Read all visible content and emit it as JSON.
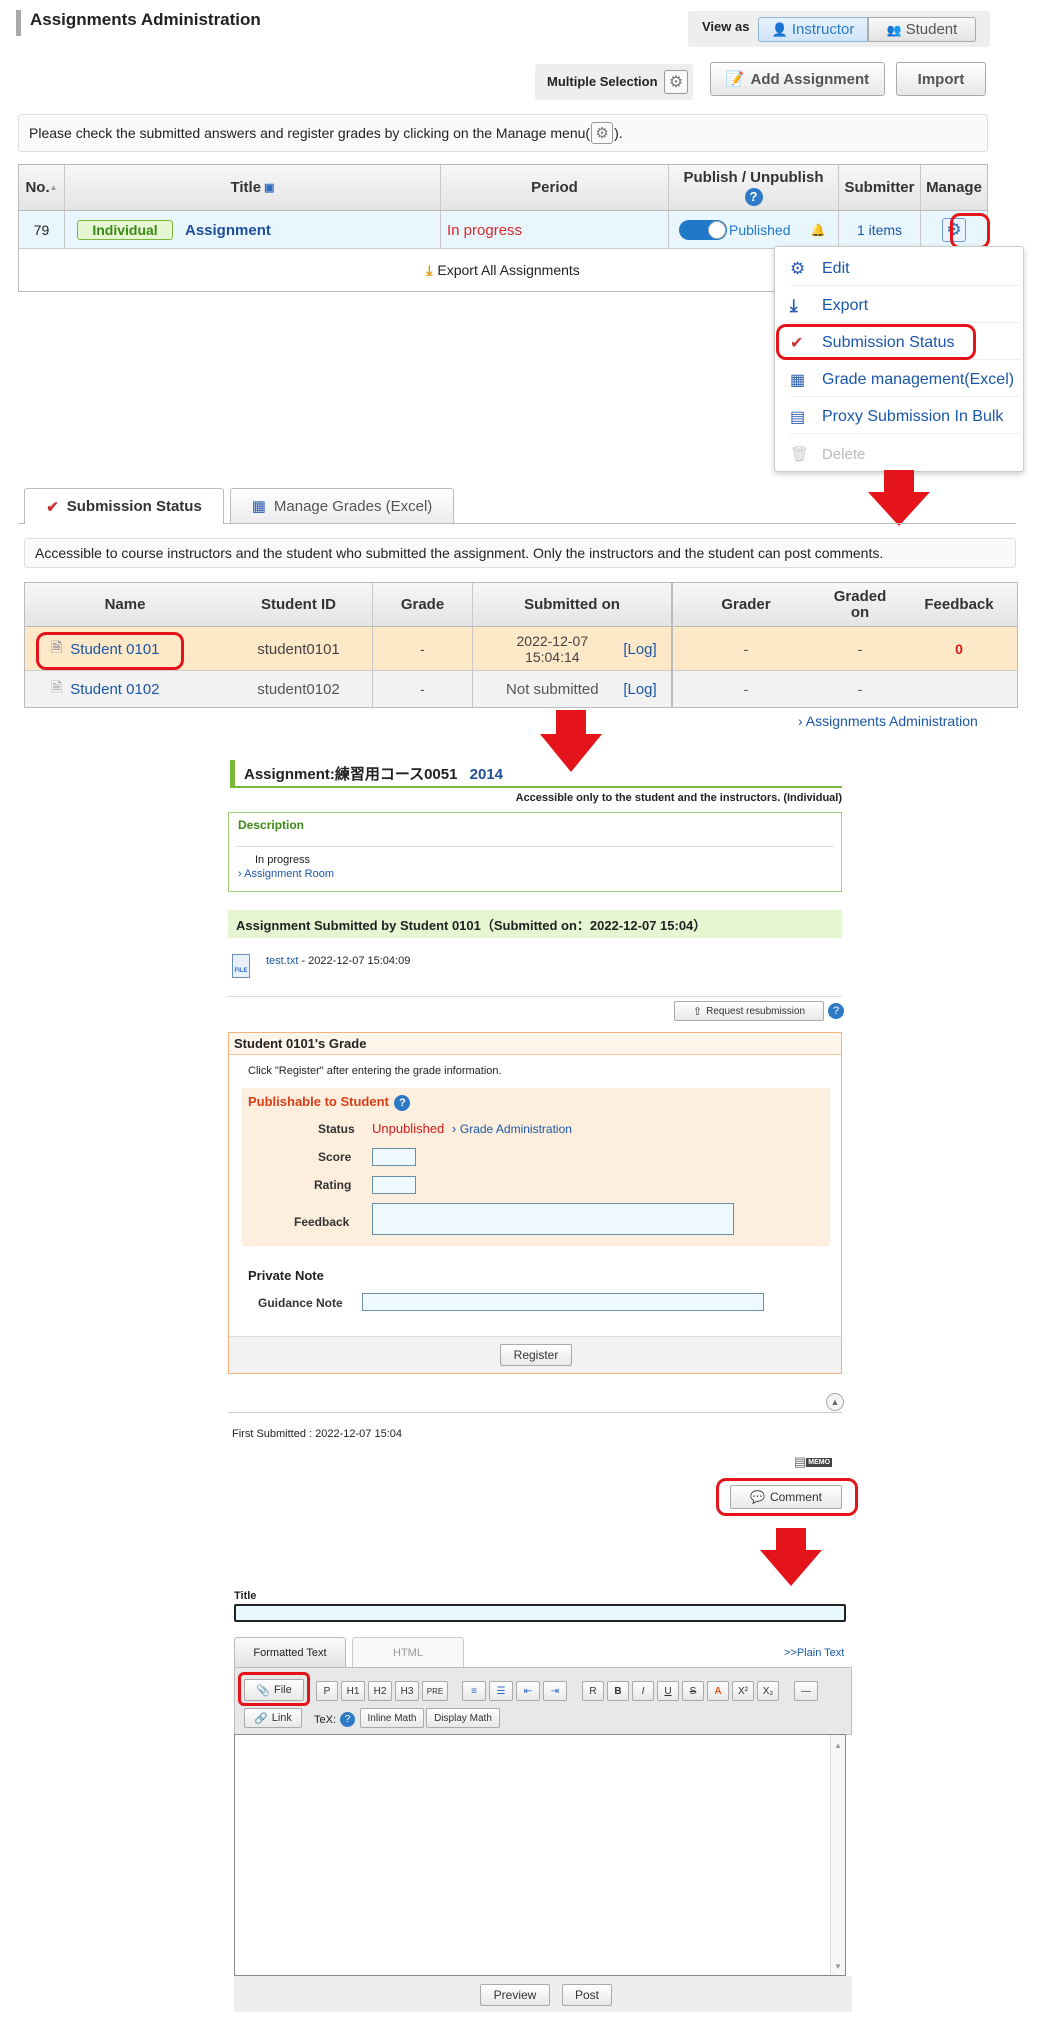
{
  "admin": {
    "title": "Assignments Administration",
    "view_as_label": "View as",
    "view_instructor": "Instructor",
    "view_student": "Student",
    "multiple_selection": "Multiple Selection",
    "add_assignment": "Add Assignment",
    "import": "Import",
    "info": "Please check the submitted answers and register grades by clicking on the Manage menu(",
    "info_end": ").",
    "table": {
      "headers": {
        "no": "No.",
        "title": "Title",
        "period": "Period",
        "publish": "Publish / Unpublish",
        "submitter": "Submitter",
        "manage": "Manage"
      },
      "row": {
        "no": "79",
        "badge": "Individual",
        "title": "Assignment",
        "period": "In progress",
        "published": "Published",
        "items": "1 items"
      }
    },
    "export_all": "Export All Assignments",
    "menu": [
      "Edit",
      "Export",
      "Submission Status",
      "Grade management(Excel)",
      "Proxy Submission In Bulk",
      "Delete"
    ]
  },
  "submission": {
    "tabs": [
      "Submission Status",
      "Manage Grades (Excel)"
    ],
    "info": "Accessible to course instructors and the student who submitted the assignment. Only the instructors and the student can post comments.",
    "headers": {
      "name": "Name",
      "student_id": "Student ID",
      "grade": "Grade",
      "submitted_on": "Submitted on",
      "grader": "Grader",
      "graded_on_1": "Graded",
      "graded_on_2": "on",
      "feedback": "Feedback"
    },
    "rows": [
      {
        "name": "Student 0101",
        "id": "student0101",
        "grade": "-",
        "submitted_1": "2022-12-07",
        "submitted_2": "15:04:14",
        "log": "[Log]",
        "grader": "-",
        "graded_on": "-",
        "feedback": "0"
      },
      {
        "name": "Student 0102",
        "id": "student0102",
        "grade": "-",
        "submitted_1": "Not submitted",
        "submitted_2": "",
        "log": "[Log]",
        "grader": "-",
        "graded_on": "-",
        "feedback": ""
      }
    ],
    "back_link": "Assignments Administration"
  },
  "detail": {
    "title": "Assignment:練習用コース0051",
    "year": "2014",
    "access_note": "Accessible only to the student and the instructors. (Individual)",
    "description_label": "Description",
    "status_text": "In progress",
    "room_link": "Assignment Room",
    "submitted_banner": "Assignment Submitted by Student 0101（Submitted on：2022-12-07 15:04）",
    "file_name": "test.txt",
    "file_time": " - 2022-12-07 15:04:09",
    "file_icon": "FILE",
    "request_resubmission": "Request resubmission",
    "grade_title": "Student 0101's Grade",
    "grade_hint": "Click \"Register\" after entering the grade information.",
    "publishable": "Publishable to Student",
    "status_label": "Status",
    "status_value": "Unpublished",
    "grade_admin_link": "Grade Administration",
    "score_label": "Score",
    "rating_label": "Rating",
    "feedback_label": "Feedback",
    "private_note": "Private Note",
    "guidance_note": "Guidance Note",
    "register": "Register",
    "first_submitted": "First Submitted : 2022-12-07 15:04",
    "memo": "MEMO",
    "comment": "Comment"
  },
  "editor": {
    "title_label": "Title",
    "tab_formatted": "Formatted Text",
    "tab_html": "HTML",
    "plain_text": ">>Plain Text",
    "file_btn": "File",
    "tools": [
      "P",
      "H1",
      "H2",
      "H3",
      "PRE"
    ],
    "fmt_tools": [
      "R",
      "B",
      "I",
      "U",
      "S",
      "A",
      "X²",
      "X₂"
    ],
    "link_btn": "Link",
    "tex_label": "TeX:",
    "inline_math": "Inline Math",
    "display_math": "Display Math",
    "preview": "Preview",
    "post": "Post"
  },
  "colors": {
    "accent_red": "#e5141b",
    "link_blue": "#1a57a8",
    "green": "#7ab83a"
  }
}
